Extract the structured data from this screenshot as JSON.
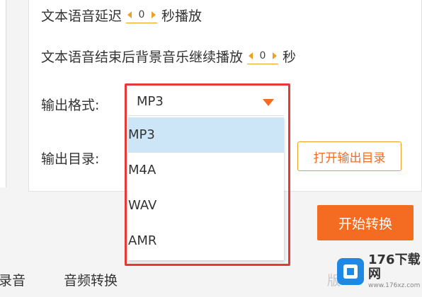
{
  "settings": {
    "tts_delay": {
      "label_before": "文本语音延迟",
      "value": "0",
      "label_after": "秒播放"
    },
    "bg_music": {
      "label_before": "文本语音结束后背景音乐继续播放",
      "value": "0",
      "label_after": "秒"
    },
    "output_format": {
      "label": "输出格式:",
      "selected": "MP3",
      "options": [
        "MP3",
        "M4A",
        "WAV",
        "AMR"
      ],
      "selected_index": 0
    },
    "output_dir": {
      "label": "输出目录:",
      "open_button": "打开输出目录"
    }
  },
  "actions": {
    "start_button": "开始转换"
  },
  "bottom_tabs": {
    "recording": "录音",
    "audio_convert": "音频转换",
    "partial": "版"
  },
  "watermark": {
    "name": "176下载网",
    "url": "www.176xz.com"
  },
  "colors": {
    "accent": "#f36c21",
    "highlight": "#e53935",
    "selected_bg": "#cde6f7"
  }
}
